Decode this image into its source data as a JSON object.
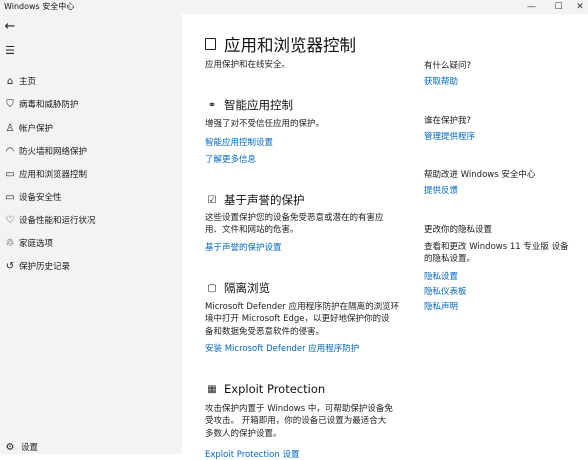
{
  "window": {
    "title": "Windows 安全中心",
    "minimize": "—",
    "maximize": "☐",
    "close": "✕"
  },
  "sidebar": {
    "items": [
      {
        "label": "主页",
        "icon": "home-icon",
        "glyph": "⌂"
      },
      {
        "label": "病毒和威胁防护",
        "icon": "shield-icon",
        "glyph": "⛉"
      },
      {
        "label": "帐户保护",
        "icon": "person-icon",
        "glyph": "♙"
      },
      {
        "label": "防火墙和网络保护",
        "icon": "wifi-icon",
        "glyph": "◠"
      },
      {
        "label": "应用和浏览器控制",
        "icon": "app-window-icon",
        "glyph": "▭"
      },
      {
        "label": "设备安全性",
        "icon": "laptop-icon",
        "glyph": "▭"
      },
      {
        "label": "设备性能和运行状况",
        "icon": "heart-icon",
        "glyph": "♡"
      },
      {
        "label": "家庭选项",
        "icon": "family-icon",
        "glyph": "♲"
      },
      {
        "label": "保护历史记录",
        "icon": "history-icon",
        "glyph": "↺"
      }
    ],
    "settings_label": "设置"
  },
  "main": {
    "title": "应用和浏览器控制",
    "subtitle": "应用保护和在线安全。",
    "sections": [
      {
        "title": "智能应用控制",
        "desc": [
          "增强了对不受信任应用的保护。"
        ],
        "links": [
          "智能应用控制设置",
          "了解更多信息"
        ]
      },
      {
        "title": "基于声誉的保护",
        "desc": [
          "这些设置保护您的设备免受恶意或潜在的有害应",
          "用、文件和网站的危害。"
        ],
        "links": [
          "基于声誉的保护设置"
        ]
      },
      {
        "title": "隔离浏览",
        "desc": [
          "Microsoft Defender 应用程序防护在隔离的浏览环",
          "境中打开 Microsoft Edge，以更好地保护你的设",
          "备和数据免受恶意软件的侵害。"
        ],
        "links": [
          "安装 Microsoft Defender 应用程序防护"
        ]
      },
      {
        "title": "Exploit Protection",
        "desc": [
          "攻击保护内置于 Windows 中，可帮助保护设备免",
          "受攻击。 开箱即用，你的设备已设置为最适合大",
          "多数人的保护设置。"
        ],
        "links": [
          "Exploit Protection 设置"
        ]
      }
    ]
  },
  "right": {
    "q_title": "有什么疑问?",
    "q_link": "获取帮助",
    "who_title": "谁在保护我?",
    "who_link": "管理提供程序",
    "improve_title": "帮助改进 Windows 安全中心",
    "improve_link": "提供反馈",
    "privacy_title": "更改你的隐私设置",
    "privacy_desc": [
      "查看和更改 Windows 11 专业版 设备",
      "的隐私设置。"
    ],
    "privacy_links": [
      "隐私设置",
      "隐私仪表板",
      "隐私声明"
    ]
  }
}
